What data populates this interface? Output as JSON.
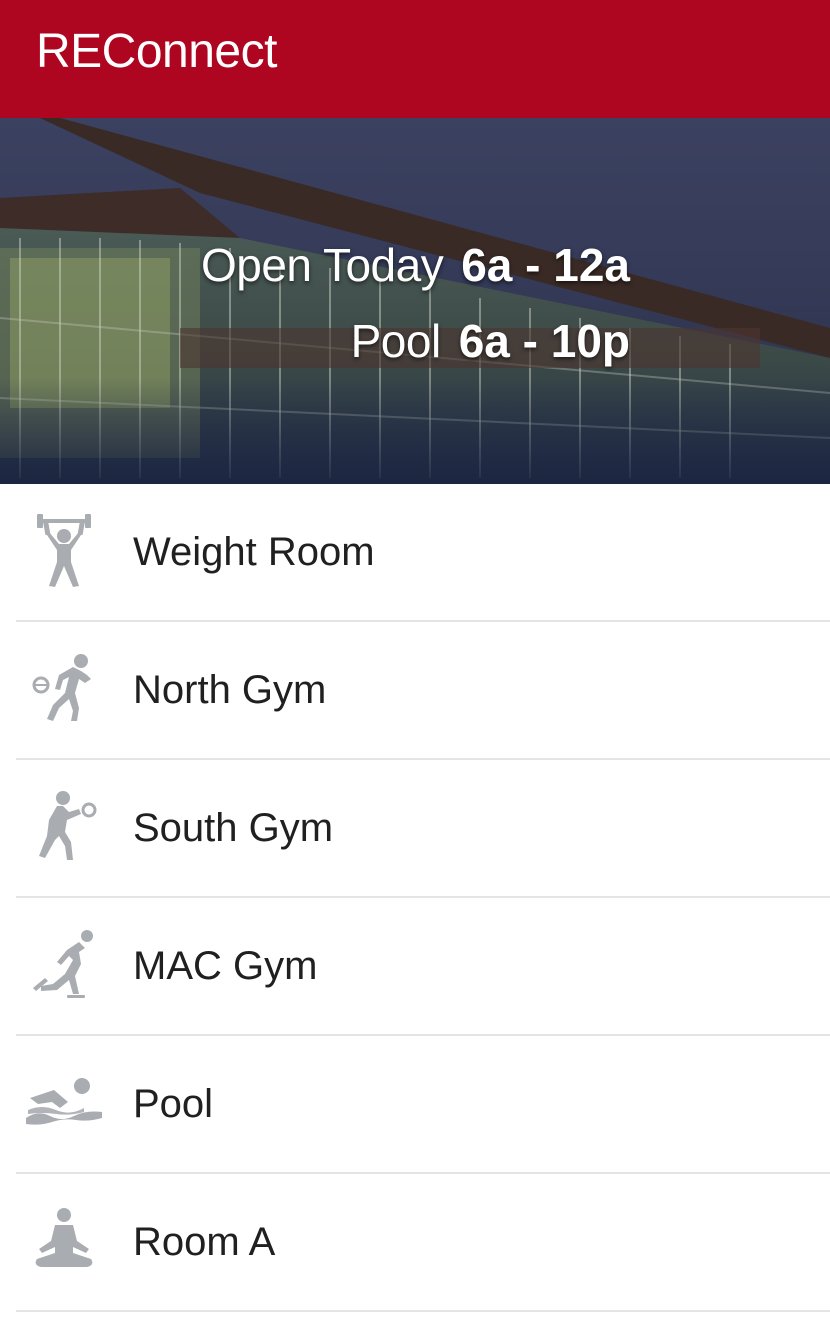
{
  "app": {
    "title": "REConnect"
  },
  "hero": {
    "today_label": "Open Today",
    "today_hours": "6a - 12a",
    "pool_label": "Pool",
    "pool_hours": "6a - 10p"
  },
  "facilities": [
    {
      "label": "Weight Room",
      "icon": "weightlifting-icon"
    },
    {
      "label": "North Gym",
      "icon": "basketball-icon"
    },
    {
      "label": "South Gym",
      "icon": "volleyball-icon"
    },
    {
      "label": "MAC Gym",
      "icon": "skating-icon"
    },
    {
      "label": "Pool",
      "icon": "swimming-icon"
    },
    {
      "label": "Room A",
      "icon": "meditation-icon"
    }
  ],
  "colors": {
    "app_bar": "#ae0521",
    "icon": "#a9adb1",
    "divider": "#e4e4e4"
  }
}
